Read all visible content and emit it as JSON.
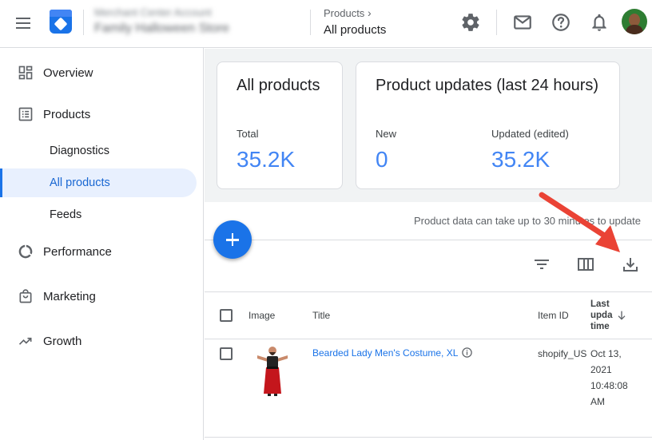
{
  "header": {
    "account_name": "Family Halloween Store",
    "account_sub": "Merchant Center Account",
    "breadcrumb_parent": "Products",
    "breadcrumb_current": "All products",
    "icons": [
      "menu-icon",
      "settings-icon",
      "mail-icon",
      "help-icon",
      "notifications-icon"
    ]
  },
  "sidebar": {
    "items": [
      {
        "label": "Overview",
        "icon": "dashboard-icon"
      },
      {
        "label": "Products",
        "icon": "list-icon"
      },
      {
        "label": "Diagnostics"
      },
      {
        "label": "All products",
        "active": true
      },
      {
        "label": "Feeds"
      },
      {
        "label": "Performance",
        "icon": "donut-icon"
      },
      {
        "label": "Marketing",
        "icon": "shopping-bag-icon"
      },
      {
        "label": "Growth",
        "icon": "trending-icon"
      }
    ]
  },
  "cards": {
    "all_products": {
      "title": "All products",
      "total_label": "Total",
      "total_value": "35.2K"
    },
    "updates": {
      "title": "Product updates (last 24 hours)",
      "new_label": "New",
      "new_value": "0",
      "updated_label": "Updated (edited)",
      "updated_value": "35.2K"
    }
  },
  "note": "Product data can take up to 30 minutes to update",
  "table": {
    "headers": {
      "image": "Image",
      "title": "Title",
      "item_id": "Item ID",
      "last_update_1": "Last",
      "last_update_2": "upda",
      "last_update_3": "time"
    },
    "rows": [
      {
        "title": "Bearded Lady Men's Costume, XL",
        "item_id": "shopify_US",
        "date_1": "Oct 13,",
        "date_2": "2021",
        "date_3": "10:48:08",
        "date_4": "AM"
      }
    ]
  },
  "colors": {
    "accent": "#1a73e8",
    "stat_blue": "#4285f4",
    "arrow": "#ea4335"
  }
}
